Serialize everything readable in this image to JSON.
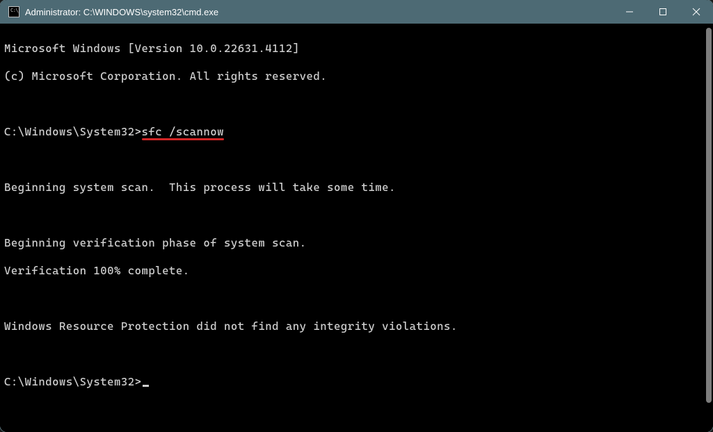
{
  "titlebar": {
    "title": "Administrator: C:\\WINDOWS\\system32\\cmd.exe"
  },
  "terminal": {
    "lines": {
      "l0": "Microsoft Windows [Version 10.0.22631.4112]",
      "l1": "(c) Microsoft Corporation. All rights reserved.",
      "l2": "",
      "prompt1_path": "C:\\Windows\\System32>",
      "prompt1_cmd": "sfc /scannow",
      "l3": "",
      "l4": "Beginning system scan.  This process will take some time.",
      "l5": "",
      "l6": "Beginning verification phase of system scan.",
      "l7": "Verification 100% complete.",
      "l8": "",
      "l9": "Windows Resource Protection did not find any integrity violations.",
      "l10": "",
      "prompt2_path": "C:\\Windows\\System32>"
    }
  }
}
